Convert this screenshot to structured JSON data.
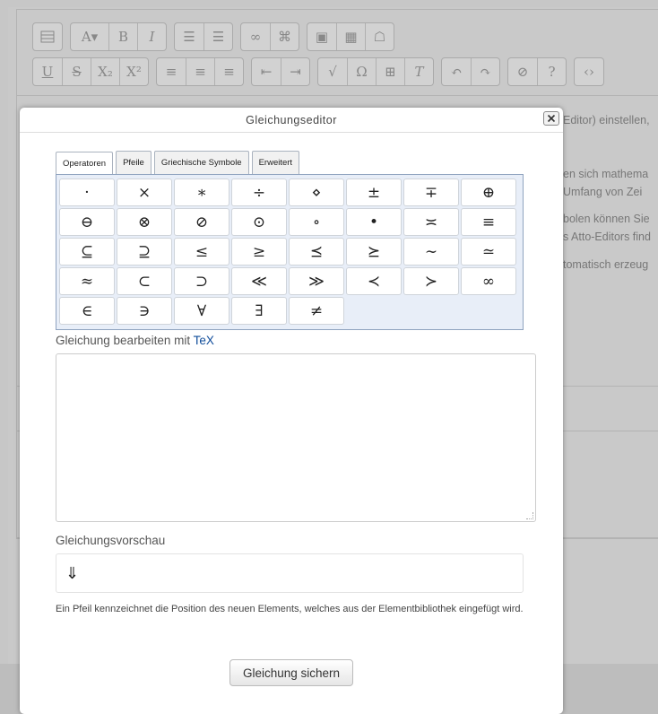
{
  "background": {
    "text_lines": [
      "Editor) einstellen,",
      "en sich mathema",
      "Umfang von Zei",
      "bolen können Sie",
      "s Atto-Editors find",
      "tomatisch erzeug"
    ],
    "toolbar": {
      "row1": [
        [
          "table-icon"
        ],
        [
          "font-style-icon",
          "bold-icon",
          "italic-icon"
        ],
        [
          "unordered-list-icon",
          "ordered-list-icon"
        ],
        [
          "link-icon",
          "unlink-icon"
        ],
        [
          "image-icon",
          "media-icon",
          "manage-files-icon"
        ]
      ],
      "row2": [
        [
          "underline-icon",
          "strikethrough-icon",
          "subscript-icon",
          "superscript-icon"
        ],
        [
          "align-left-icon",
          "align-center-icon",
          "align-right-icon"
        ],
        [
          "outdent-icon",
          "indent-icon"
        ],
        [
          "equation-icon",
          "special-char-icon",
          "table-icon",
          "clear-format-icon"
        ],
        [
          "undo-icon",
          "redo-icon"
        ],
        [
          "accessibility-icon",
          "help-icon"
        ],
        [
          "html-icon"
        ]
      ]
    }
  },
  "dialog": {
    "title": "Gleichungseditor",
    "tabs": [
      {
        "label": "Operatoren",
        "active": true
      },
      {
        "label": "Pfeile",
        "active": false
      },
      {
        "label": "Griechische Symbole",
        "active": false
      },
      {
        "label": "Erweitert",
        "active": false
      }
    ],
    "symbols": [
      "·",
      "×",
      "∗",
      "÷",
      "⋄",
      "±",
      "∓",
      "⊕",
      "⊖",
      "⊗",
      "⊘",
      "⊙",
      "∘",
      "•",
      "≍",
      "≡",
      "⊆",
      "⊇",
      "≤",
      "≥",
      "⪯",
      "⪰",
      "∼",
      "≃",
      "≈",
      "⊂",
      "⊃",
      "≪",
      "≫",
      "≺",
      "≻",
      "∞",
      "∈",
      "∋",
      "∀",
      "∃",
      "≠"
    ],
    "edit_label_prefix": "Gleichung bearbeiten mit ",
    "edit_label_link": "TeX",
    "textarea_value": "",
    "preview_label": "Gleichungsvorschau",
    "preview_content": "⇓",
    "help_text": "Ein Pfeil kennzeichnet die Position des neuen Elements, welches aus der Elementbibliothek eingefügt wird.",
    "save_label": "Gleichung sichern"
  },
  "colors": {
    "overlay_bg": "#c9c9c9",
    "dialog_bg": "#ffffff",
    "grid_bg": "#e8eef8",
    "link": "#0f4c9a"
  }
}
